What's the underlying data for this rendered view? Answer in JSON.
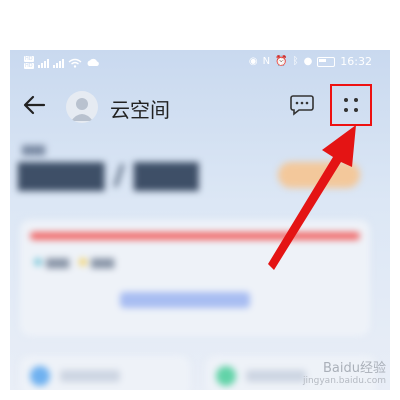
{
  "status_bar": {
    "time": "16:32",
    "sim1": "HD",
    "sim2": "HD",
    "sim1_network": "4G",
    "sim2_network": "4G",
    "battery": "60"
  },
  "header": {
    "title": "云空间"
  },
  "watermark": {
    "brand": "Baidu经验",
    "url": "jingyan.baidu.com"
  },
  "colors": {
    "highlight": "#e11111",
    "arrow": "#e11111"
  }
}
